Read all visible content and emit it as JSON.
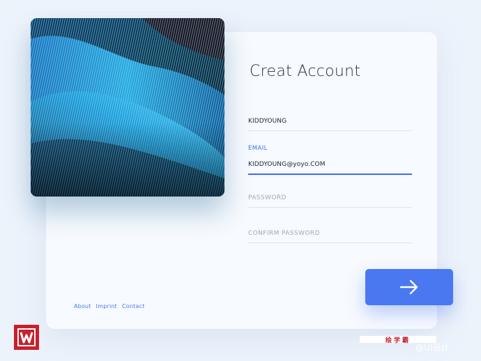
{
  "form": {
    "title": "Creat Account",
    "fields": [
      {
        "label": "",
        "value": "KIDDYOUNG",
        "placeholder": ""
      },
      {
        "label": "EMAIL",
        "value": "KIDDYOUNG@yoyo.COM",
        "placeholder": ""
      },
      {
        "label": "",
        "value": "",
        "placeholder": "PASSWORD"
      },
      {
        "label": "",
        "value": "",
        "placeholder": "CONFIRM PASSWORD"
      }
    ],
    "submit_icon": "arrow-right-icon"
  },
  "footer": {
    "links": [
      "About",
      "Imprint",
      "Contact"
    ]
  },
  "watermark": {
    "logo_icon": "w-logo-icon",
    "badge_text": "绘学霸",
    "weibo_text": "@UI设计"
  },
  "colors": {
    "accent": "#4a78f1",
    "background": "#edf3fb",
    "card": "#f7fafe"
  }
}
